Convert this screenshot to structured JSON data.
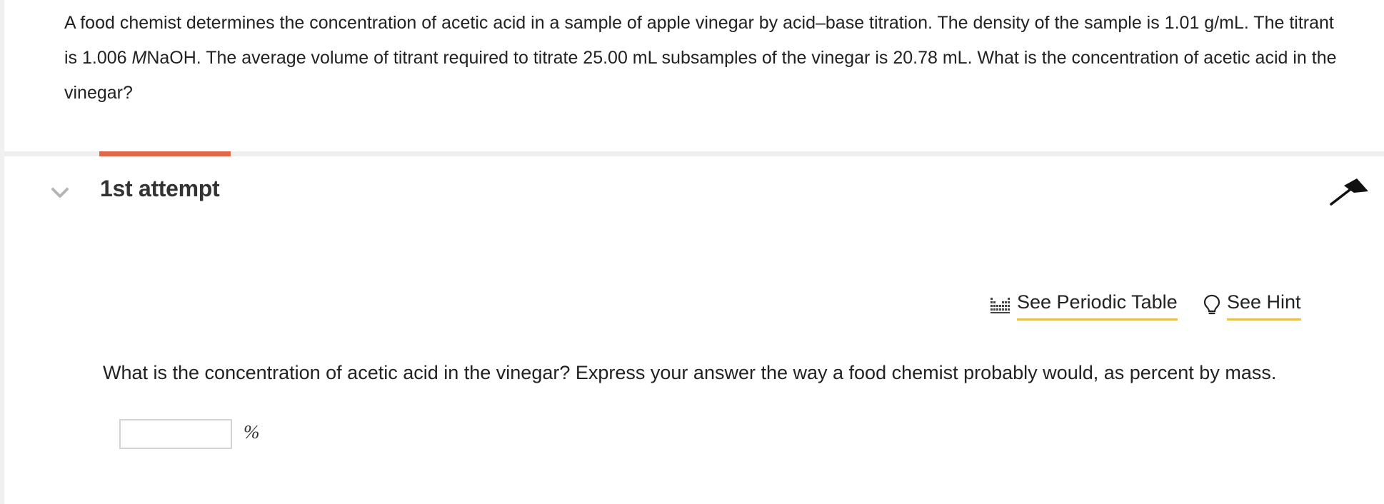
{
  "question": {
    "text_part1": "A food chemist determines the concentration of acetic acid in a sample of apple vinegar by acid–base titration. The density of the sample is 1.01 g/mL. The titrant is 1.006 ",
    "molarity_symbol": "M",
    "text_part2": "NaOH. The average volume of titrant required to titrate 25.00 mL subsamples of the vinegar is 20.78 mL. What is the concentration of acetic acid in the vinegar?"
  },
  "attempt": {
    "title": "1st attempt",
    "progress_color": "#e0694a"
  },
  "tools": {
    "periodic_table_label": "See Periodic Table",
    "hint_label": "See Hint",
    "underline_color": "#e8c24a"
  },
  "part": {
    "prompt": "What is the concentration of acetic acid in the vinegar? Express your answer the way a food chemist probably would, as percent by mass.",
    "answer_value": "",
    "answer_placeholder": "",
    "unit": "%"
  },
  "icons": {
    "collapse": "chevron-down-icon",
    "flag": "flag-icon",
    "periodic_table": "periodic-table-icon",
    "hint": "lightbulb-icon"
  }
}
